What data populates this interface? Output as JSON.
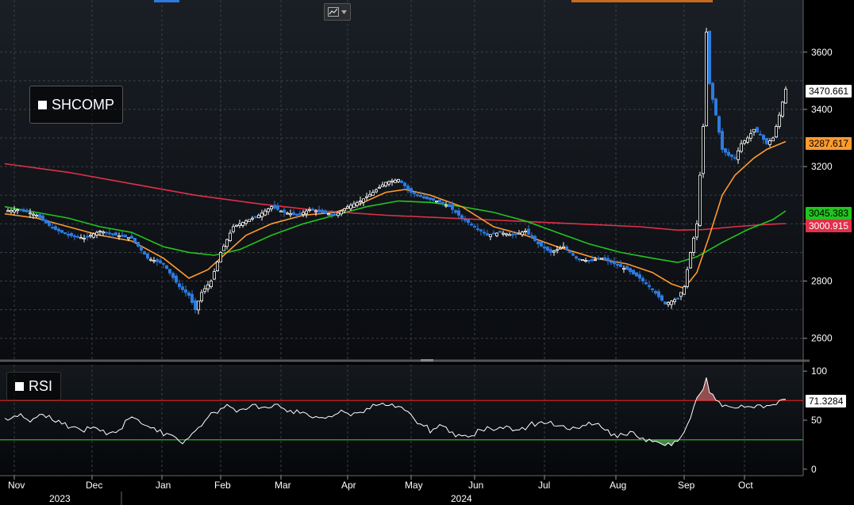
{
  "colors": {
    "background": "#000000",
    "plot_bg_top": "#1a1f25",
    "grid": "#3a3f45",
    "candle_up": "#ffffff",
    "candle_down": "#2d7be0",
    "ma_short": "#ff9a2e",
    "ma_mid": "#22c41e",
    "ma_long": "#e0304a",
    "rsi_line": "#ffffff",
    "rsi_upper": "#d02020",
    "rsi_lower": "#30b030"
  },
  "toolbar": {
    "chart_type_icon": "line-chart-icon",
    "dropdown_icon": "chevron-down-icon"
  },
  "legend": {
    "main": "SHCOMP",
    "rsi": "RSI"
  },
  "chart_data": [
    {
      "type": "candlestick",
      "series_name": "SHCOMP",
      "ylim": [
        2530,
        3760
      ],
      "yticks": [
        "3600",
        "3400",
        "3200",
        "3000",
        "2800",
        "2600"
      ],
      "ytick_values": [
        3600,
        3400,
        3200,
        3000,
        2800,
        2600
      ],
      "x_months": [
        "Nov",
        "Dec",
        "Jan",
        "Feb",
        "Mar",
        "Apr",
        "May",
        "Jun",
        "Jul",
        "Aug",
        "Sep",
        "Oct"
      ],
      "x_years": [
        "2023",
        "2024"
      ],
      "last_values": {
        "close": "3470.661",
        "ma_short": "3287.617",
        "ma_mid": "3045.383",
        "ma_long": "3000.915"
      },
      "close_points": [
        [
          0,
          3045
        ],
        [
          5,
          3050
        ],
        [
          10,
          3030
        ],
        [
          15,
          2985
        ],
        [
          20,
          2960
        ],
        [
          25,
          2950
        ],
        [
          30,
          2975
        ],
        [
          35,
          2960
        ],
        [
          40,
          2950
        ],
        [
          45,
          2880
        ],
        [
          50,
          2860
        ],
        [
          55,
          2780
        ],
        [
          58,
          2750
        ],
        [
          60,
          2700
        ],
        [
          62,
          2760
        ],
        [
          65,
          2800
        ],
        [
          68,
          2900
        ],
        [
          72,
          2990
        ],
        [
          76,
          3010
        ],
        [
          80,
          3030
        ],
        [
          84,
          3060
        ],
        [
          88,
          3040
        ],
        [
          92,
          3030
        ],
        [
          96,
          3050
        ],
        [
          100,
          3040
        ],
        [
          104,
          3030
        ],
        [
          108,
          3060
        ],
        [
          112,
          3080
        ],
        [
          116,
          3110
        ],
        [
          120,
          3145
        ],
        [
          124,
          3155
        ],
        [
          128,
          3110
        ],
        [
          132,
          3090
        ],
        [
          136,
          3080
        ],
        [
          140,
          3060
        ],
        [
          144,
          3020
        ],
        [
          148,
          2990
        ],
        [
          152,
          2960
        ],
        [
          156,
          2970
        ],
        [
          160,
          2960
        ],
        [
          164,
          2975
        ],
        [
          168,
          2930
        ],
        [
          172,
          2900
        ],
        [
          176,
          2920
        ],
        [
          180,
          2880
        ],
        [
          184,
          2870
        ],
        [
          188,
          2880
        ],
        [
          192,
          2860
        ],
        [
          196,
          2840
        ],
        [
          200,
          2810
        ],
        [
          204,
          2770
        ],
        [
          208,
          2720
        ],
        [
          212,
          2740
        ],
        [
          214,
          2780
        ],
        [
          216,
          2900
        ],
        [
          218,
          3000
        ],
        [
          220,
          3340
        ],
        [
          221,
          3670
        ],
        [
          222,
          3490
        ],
        [
          224,
          3380
        ],
        [
          226,
          3260
        ],
        [
          228,
          3240
        ],
        [
          230,
          3230
        ],
        [
          232,
          3280
        ],
        [
          234,
          3300
        ],
        [
          236,
          3330
        ],
        [
          238,
          3310
        ],
        [
          240,
          3280
        ],
        [
          242,
          3300
        ],
        [
          244,
          3380
        ],
        [
          246,
          3470.661
        ]
      ],
      "ma_short_points": [
        [
          0,
          3035
        ],
        [
          10,
          3020
        ],
        [
          20,
          2990
        ],
        [
          30,
          2960
        ],
        [
          40,
          2940
        ],
        [
          50,
          2880
        ],
        [
          58,
          2810
        ],
        [
          64,
          2840
        ],
        [
          70,
          2900
        ],
        [
          76,
          2960
        ],
        [
          84,
          3000
        ],
        [
          94,
          3030
        ],
        [
          104,
          3040
        ],
        [
          112,
          3070
        ],
        [
          120,
          3110
        ],
        [
          126,
          3120
        ],
        [
          134,
          3100
        ],
        [
          144,
          3060
        ],
        [
          154,
          2990
        ],
        [
          164,
          2960
        ],
        [
          174,
          2920
        ],
        [
          186,
          2880
        ],
        [
          196,
          2860
        ],
        [
          204,
          2830
        ],
        [
          210,
          2790
        ],
        [
          214,
          2775
        ],
        [
          218,
          2830
        ],
        [
          222,
          2960
        ],
        [
          226,
          3100
        ],
        [
          230,
          3170
        ],
        [
          236,
          3230
        ],
        [
          240,
          3260
        ],
        [
          246,
          3287.617
        ]
      ],
      "ma_mid_points": [
        [
          0,
          3060
        ],
        [
          10,
          3040
        ],
        [
          20,
          3020
        ],
        [
          30,
          2990
        ],
        [
          40,
          2970
        ],
        [
          50,
          2920
        ],
        [
          58,
          2900
        ],
        [
          66,
          2890
        ],
        [
          74,
          2910
        ],
        [
          84,
          2960
        ],
        [
          94,
          3000
        ],
        [
          104,
          3030
        ],
        [
          114,
          3060
        ],
        [
          124,
          3080
        ],
        [
          134,
          3075
        ],
        [
          144,
          3060
        ],
        [
          154,
          3040
        ],
        [
          164,
          3010
        ],
        [
          174,
          2970
        ],
        [
          184,
          2930
        ],
        [
          194,
          2900
        ],
        [
          204,
          2880
        ],
        [
          212,
          2865
        ],
        [
          218,
          2885
        ],
        [
          226,
          2935
        ],
        [
          234,
          2980
        ],
        [
          242,
          3015
        ],
        [
          246,
          3045.383
        ]
      ],
      "ma_long_points": [
        [
          0,
          3210
        ],
        [
          20,
          3180
        ],
        [
          40,
          3140
        ],
        [
          60,
          3100
        ],
        [
          80,
          3070
        ],
        [
          100,
          3045
        ],
        [
          120,
          3030
        ],
        [
          140,
          3020
        ],
        [
          160,
          3010
        ],
        [
          180,
          3000
        ],
        [
          200,
          2990
        ],
        [
          212,
          2978
        ],
        [
          220,
          2980
        ],
        [
          230,
          2990
        ],
        [
          240,
          2998
        ],
        [
          246,
          3000.915
        ]
      ]
    },
    {
      "type": "line",
      "series_name": "RSI",
      "ylim": [
        -5,
        105
      ],
      "yticks": [
        "100",
        "50",
        "0"
      ],
      "ytick_values": [
        100,
        50,
        0
      ],
      "upper_band": 70,
      "lower_band": 30,
      "last_value": "71.3284",
      "points": [
        [
          0,
          52
        ],
        [
          4,
          55
        ],
        [
          8,
          50
        ],
        [
          12,
          56
        ],
        [
          16,
          48
        ],
        [
          20,
          44
        ],
        [
          24,
          40
        ],
        [
          28,
          42
        ],
        [
          32,
          36
        ],
        [
          36,
          40
        ],
        [
          40,
          55
        ],
        [
          44,
          46
        ],
        [
          48,
          38
        ],
        [
          52,
          36
        ],
        [
          56,
          28
        ],
        [
          58,
          32
        ],
        [
          62,
          46
        ],
        [
          66,
          58
        ],
        [
          70,
          64
        ],
        [
          74,
          60
        ],
        [
          78,
          66
        ],
        [
          82,
          62
        ],
        [
          86,
          64
        ],
        [
          90,
          60
        ],
        [
          94,
          56
        ],
        [
          98,
          52
        ],
        [
          102,
          54
        ],
        [
          106,
          58
        ],
        [
          110,
          56
        ],
        [
          114,
          62
        ],
        [
          118,
          66
        ],
        [
          122,
          64
        ],
        [
          126,
          60
        ],
        [
          130,
          48
        ],
        [
          134,
          40
        ],
        [
          138,
          44
        ],
        [
          142,
          36
        ],
        [
          146,
          32
        ],
        [
          150,
          40
        ],
        [
          154,
          42
        ],
        [
          158,
          44
        ],
        [
          162,
          40
        ],
        [
          166,
          46
        ],
        [
          170,
          48
        ],
        [
          174,
          44
        ],
        [
          178,
          40
        ],
        [
          182,
          44
        ],
        [
          186,
          46
        ],
        [
          190,
          38
        ],
        [
          194,
          34
        ],
        [
          198,
          38
        ],
        [
          202,
          30
        ],
        [
          206,
          26
        ],
        [
          210,
          24
        ],
        [
          214,
          36
        ],
        [
          216,
          52
        ],
        [
          218,
          70
        ],
        [
          220,
          84
        ],
        [
          221,
          92
        ],
        [
          222,
          78
        ],
        [
          226,
          66
        ],
        [
          230,
          62
        ],
        [
          234,
          64
        ],
        [
          238,
          66
        ],
        [
          242,
          64
        ],
        [
          246,
          71.3284
        ]
      ]
    }
  ]
}
